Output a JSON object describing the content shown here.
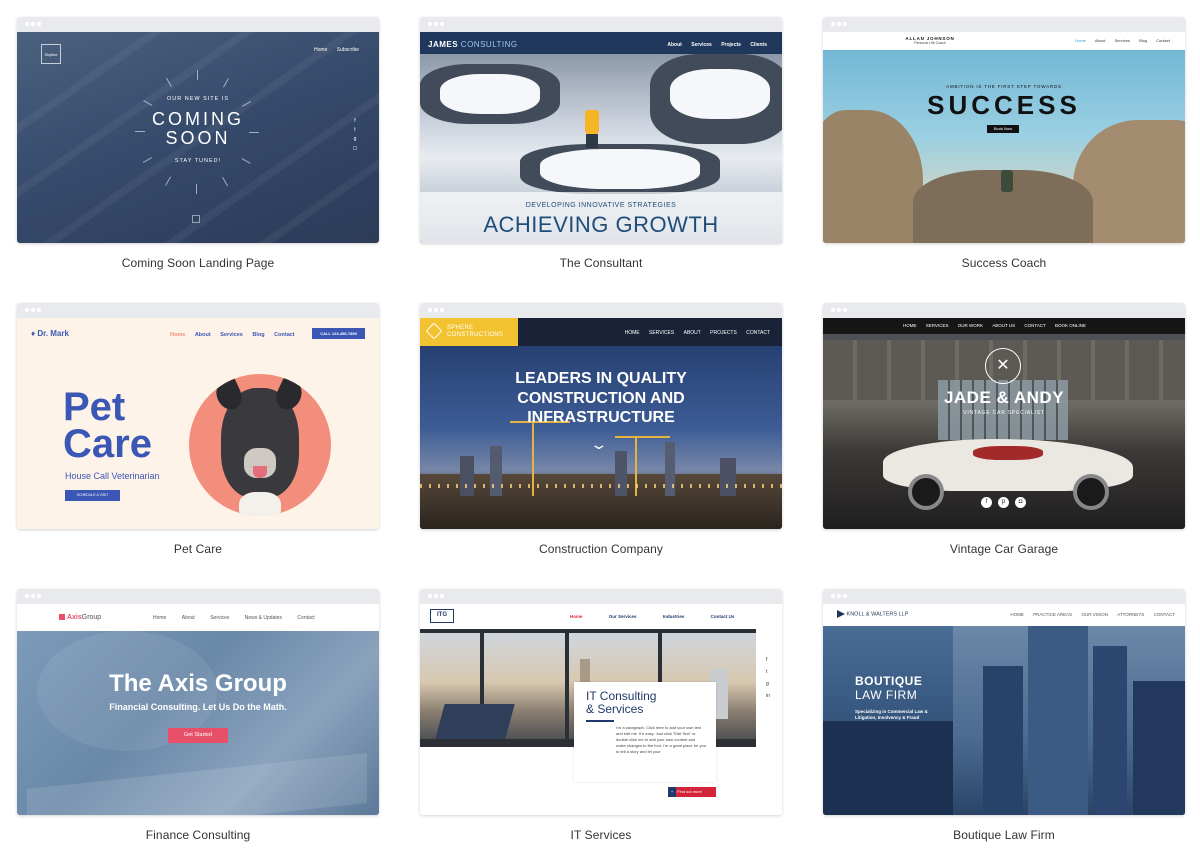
{
  "templates": [
    {
      "caption": "Coming Soon Landing Page",
      "logo": "Skyline",
      "nav": [
        "Home",
        "Subscribe"
      ],
      "kicker": "OUR NEW SITE IS",
      "headline_1": "COMING",
      "headline_2": "SOON",
      "tagline": "STAY TUNED!"
    },
    {
      "caption": "The Consultant",
      "logo_bold": "JAMES",
      "logo_light": "CONSULTING",
      "nav": [
        "About",
        "Services",
        "Projects",
        "Clients"
      ],
      "kicker": "DEVELOPING INNOVATIVE STRATEGIES",
      "headline": "ACHIEVING GROWTH"
    },
    {
      "caption": "Success Coach",
      "logo": "ALLAN JOHNSON",
      "logo_sub": "Personal Life Coach",
      "nav": [
        "Home",
        "About",
        "Services",
        "Blog",
        "Contact"
      ],
      "kicker": "AMBITION IS THE FIRST STEP TOWARDS",
      "headline": "SUCCESS",
      "button": "Book Now"
    },
    {
      "caption": "Pet Care",
      "logo": "Dr. Mark",
      "nav": [
        "Home",
        "About",
        "Services",
        "Blog",
        "Contact"
      ],
      "phone": "CALL 123-456-7890",
      "headline_1": "Pet",
      "headline_2": "Care",
      "subtitle": "House Call Veterinarian",
      "button": "SCHEDULE A VISIT",
      "accent": "#3b57b5"
    },
    {
      "caption": "Construction Company",
      "logo_1": "SPHERE",
      "logo_2": "CONSTRUCTIONS",
      "nav": [
        "HOME",
        "SERVICES",
        "ABOUT",
        "PROJECTS",
        "CONTACT"
      ],
      "headline_1": "LEADERS IN QUALITY",
      "headline_2": "CONSTRUCTION AND",
      "headline_3": "INFRASTRUCTURE",
      "accent": "#f2c230"
    },
    {
      "caption": "Vintage Car Garage",
      "nav": [
        "HOME",
        "SERVICES",
        "OUR WORK",
        "ABOUT US",
        "CONTACT",
        "BOOK ONLINE"
      ],
      "headline": "JADE & ANDY",
      "subtitle": "VINTAGE CAR SPECIALIST"
    },
    {
      "caption": "Finance Consulting",
      "logo_bold": "Axis",
      "logo_light": "Group",
      "nav": [
        "Home",
        "About",
        "Services",
        "News & Updates",
        "Contact"
      ],
      "headline": "The Axis Group",
      "subtitle": "Financial Consulting. Let Us Do the Math.",
      "button": "Get Started",
      "accent": "#e8506a"
    },
    {
      "caption": "IT Services",
      "logo": "ITG",
      "nav": [
        "Home",
        "Our Services",
        "Industries",
        "Contact Us"
      ],
      "headline_1": "IT Consulting",
      "headline_2": "& Services",
      "body": "I'm a paragraph. Click here to add your own text and edit me. It's easy. Just click \"Edit Text\" or double click me to add your own content and make changes to the font. I'm a great place for you to tell a story and let your",
      "button": "Find out more",
      "accent": "#d3243b"
    },
    {
      "caption": "Boutique Law Firm",
      "logo": "KNOLL & WALTERS LLP",
      "nav": [
        "HOME",
        "PRACTICE AREAS",
        "OUR VISION",
        "ATTORNEYS",
        "CONTACT"
      ],
      "headline_1": "BOUTIQUE",
      "headline_2": "LAW FIRM",
      "subtitle_1": "Specializing in Commercial Law &",
      "subtitle_2": "Litigation, Insolvency & Fraud"
    }
  ]
}
